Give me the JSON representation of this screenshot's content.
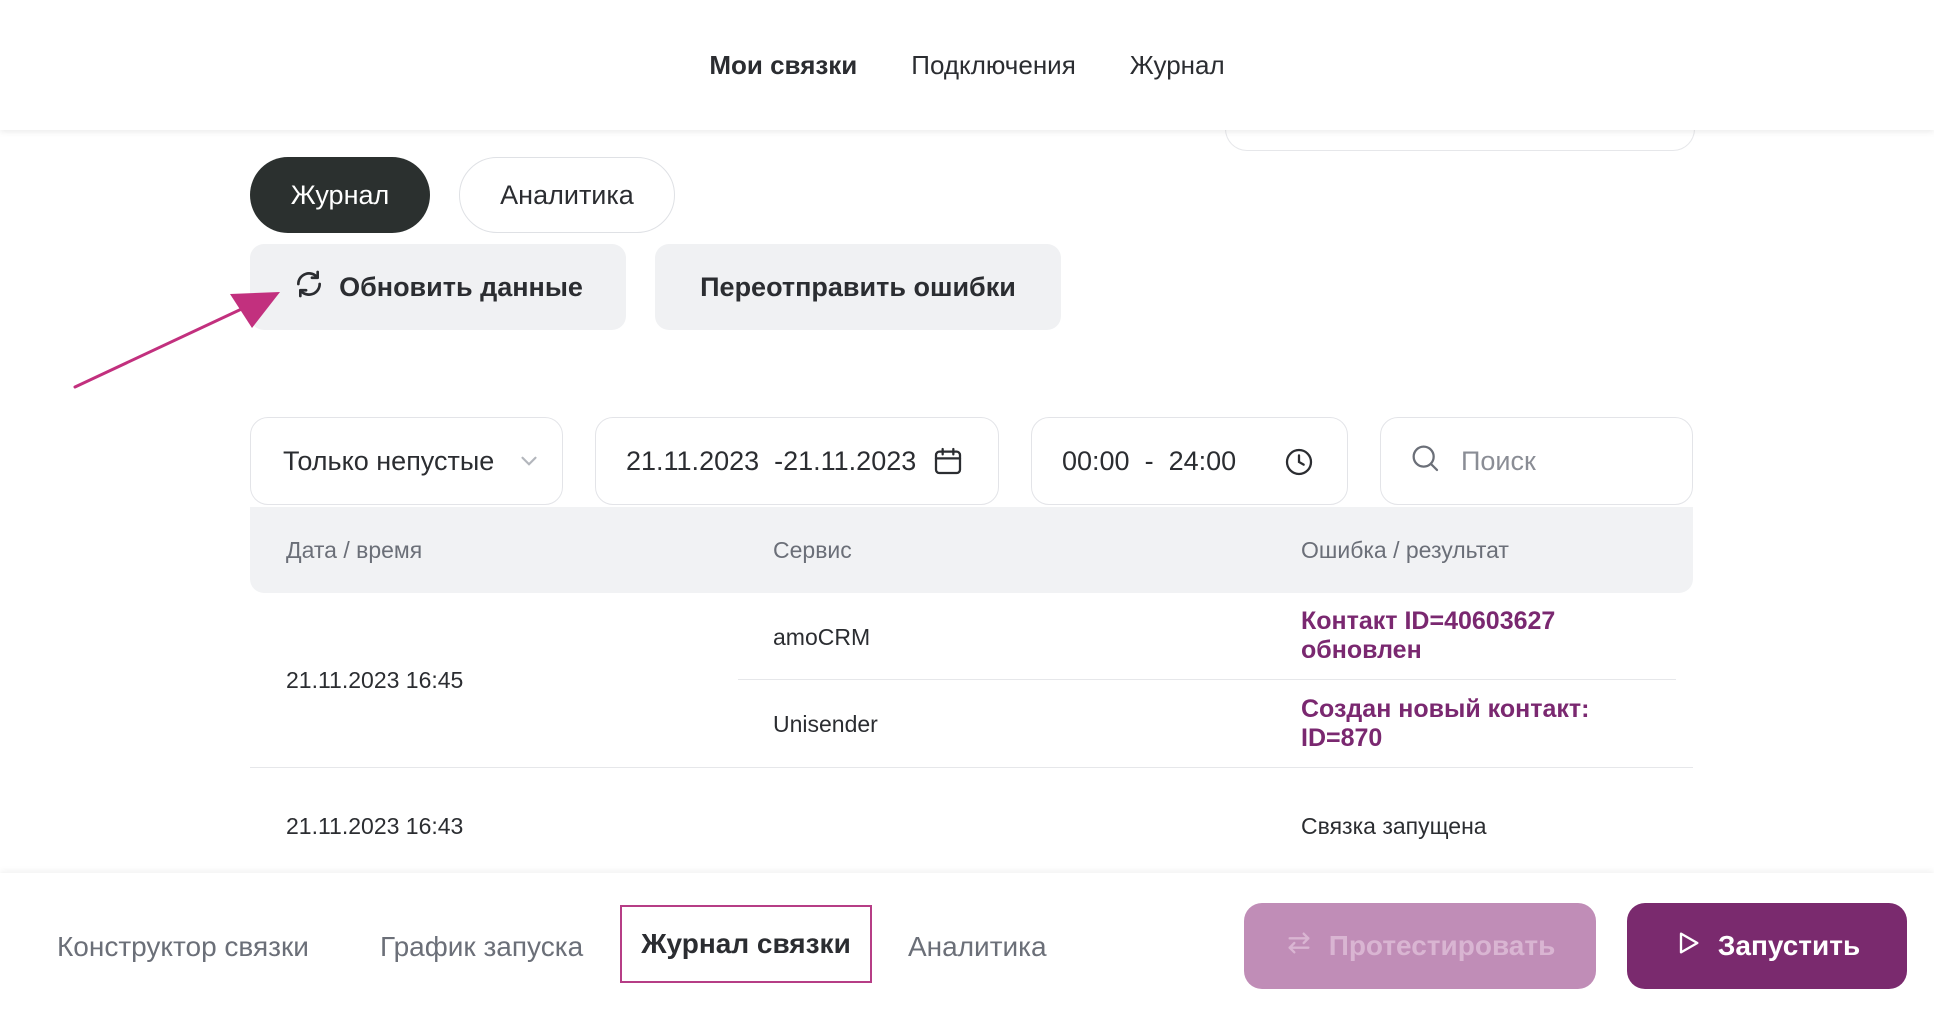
{
  "topnav": {
    "items": [
      "Мои связки",
      "Подключения",
      "Журнал"
    ]
  },
  "tabs": {
    "journal": "Журнал",
    "analytics": "Аналитика"
  },
  "actions": {
    "refresh": "Обновить данные",
    "resend": "Переотправить ошибки"
  },
  "filters": {
    "mode": "Только непустые",
    "date_range": "21.11.2023  -21.11.2023",
    "time_range": "00:00  -  24:00",
    "search_placeholder": "Поиск"
  },
  "table": {
    "headers": [
      "Дата / время",
      "Сервис",
      "Ошибка / результат"
    ],
    "rows": [
      {
        "datetime": "21.11.2023 16:45",
        "entries": [
          {
            "service": "amoCRM",
            "result": "Контакт ID=40603627 обновлен"
          },
          {
            "service": "Unisender",
            "result": "Создан новый контакт: ID=870"
          }
        ]
      },
      {
        "datetime": "21.11.2023 16:43",
        "entries": [
          {
            "service": "",
            "result": "Связка запущена"
          }
        ]
      }
    ]
  },
  "bottom": {
    "tabs": [
      "Конструктор связки",
      "График запуска",
      "Журнал связки",
      "Аналитика"
    ],
    "test_button": "Протестировать",
    "run_button": "Запустить"
  },
  "colors": {
    "accent": "#7a2a6e",
    "result_text": "#7a2870",
    "highlight_border": "#b63d86",
    "arrow": "#c2307e"
  }
}
